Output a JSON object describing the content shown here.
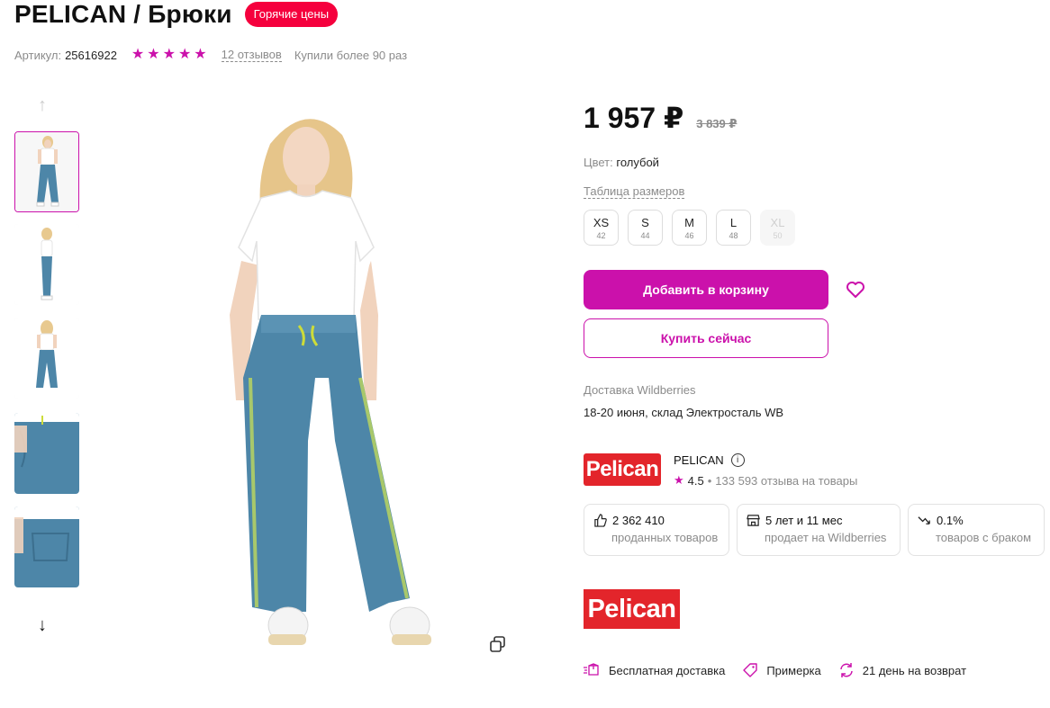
{
  "product": {
    "title": "PELICAN / Брюки",
    "hot_badge": "Горячие цены",
    "article_label": "Артикул:",
    "article_value": "25616922",
    "rating_stars": 5,
    "reviews": "12 отзывов",
    "bought": "Купили более 90 раз"
  },
  "gallery": {
    "thumbs": [
      "front",
      "side",
      "back",
      "pocket-detail",
      "back-detail"
    ],
    "active_index": 0
  },
  "price": {
    "current": "1 957 ₽",
    "old": "3 839 ₽"
  },
  "color": {
    "label": "Цвет:",
    "value": "голубой"
  },
  "size_table_link": "Таблица размеров",
  "sizes": [
    {
      "size": "XS",
      "num": "42",
      "available": true
    },
    {
      "size": "S",
      "num": "44",
      "available": true
    },
    {
      "size": "M",
      "num": "46",
      "available": true
    },
    {
      "size": "L",
      "num": "48",
      "available": true
    },
    {
      "size": "XL",
      "num": "50",
      "available": false
    }
  ],
  "buttons": {
    "add_to_cart": "Добавить в корзину",
    "buy_now": "Купить сейчас"
  },
  "delivery": {
    "label": "Доставка Wildberries",
    "text": "18-20 июня, склад Электросталь WB"
  },
  "seller": {
    "logo_text": "Pelican",
    "name": "PELICAN",
    "rating": "4.5",
    "separator": "•",
    "reviews": "133 593 отзыва на товары"
  },
  "stats": [
    {
      "icon": "thumbs-up-icon",
      "value": "2 362 410",
      "label": "проданных товаров"
    },
    {
      "icon": "store-icon",
      "value": "5 лет и 11 мес",
      "label": "продает на Wildberries"
    },
    {
      "icon": "trend-down-icon",
      "value": "0.1%",
      "label": "товаров с браком"
    }
  ],
  "brand_logo": "Pelican",
  "features": [
    {
      "icon": "free-delivery-icon",
      "label": "Бесплатная доставка"
    },
    {
      "icon": "tag-icon",
      "label": "Примерка"
    },
    {
      "icon": "return-icon",
      "label": "21 день на возврат"
    }
  ],
  "colors": {
    "accent": "#cb11ab",
    "hot": "#f5003d",
    "brand_red": "#e3252b",
    "jeans": "#4d86a8"
  }
}
